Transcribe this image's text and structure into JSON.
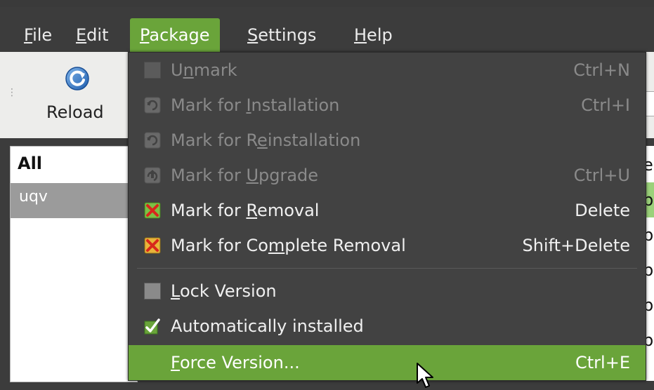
{
  "menubar": {
    "items": [
      {
        "accel": "F",
        "rest": "ile"
      },
      {
        "accel": "E",
        "rest": "dit"
      },
      {
        "accel": "P",
        "rest": "ackage"
      },
      {
        "accel": "S",
        "rest": "ettings"
      },
      {
        "accel": "H",
        "rest": "elp"
      }
    ]
  },
  "toolbar": {
    "reload_label": "Reload",
    "reload_icon": "reload-icon"
  },
  "filters": {
    "all_label": "All",
    "selected_label": "uqv"
  },
  "partial_column": [
    "er",
    "b",
    "b",
    "b",
    "b",
    "b"
  ],
  "package_menu": {
    "items": [
      {
        "pre": "U",
        "accel": "n",
        "post": "mark",
        "shortcut": "Ctrl+N",
        "icon": "unmark-icon",
        "enabled": false
      },
      {
        "pre": "Mark for ",
        "accel": "I",
        "post": "nstallation",
        "shortcut": "Ctrl+I",
        "icon": "install-icon",
        "enabled": false
      },
      {
        "pre": "Mark for R",
        "accel": "e",
        "post": "installation",
        "shortcut": "",
        "icon": "reinstall-icon",
        "enabled": false
      },
      {
        "pre": "Mark for ",
        "accel": "U",
        "post": "pgrade",
        "shortcut": "Ctrl+U",
        "icon": "upgrade-icon",
        "enabled": false
      },
      {
        "pre": "Mark for ",
        "accel": "R",
        "post": "emoval",
        "shortcut": "Delete",
        "icon": "removal-icon",
        "enabled": true
      },
      {
        "pre": "Mark for Co",
        "accel": "m",
        "post": "plete Removal",
        "shortcut": "Shift+Delete",
        "icon": "complete-removal-icon",
        "enabled": true
      },
      {
        "pre": "",
        "accel": "L",
        "post": "ock Version",
        "shortcut": "",
        "icon": "checkbox-unchecked-icon",
        "enabled": true
      },
      {
        "pre": "",
        "accel": "",
        "post": "Automatically installed",
        "shortcut": "",
        "icon": "checkbox-checked-icon",
        "enabled": true
      },
      {
        "pre": "",
        "accel": "F",
        "post": "orce Version...",
        "shortcut": "Ctrl+E",
        "icon": "",
        "enabled": true
      }
    ]
  },
  "colors": {
    "accent": "#6aa43a",
    "menu_bg": "#424242",
    "disabled_text": "#8a8a8a"
  }
}
